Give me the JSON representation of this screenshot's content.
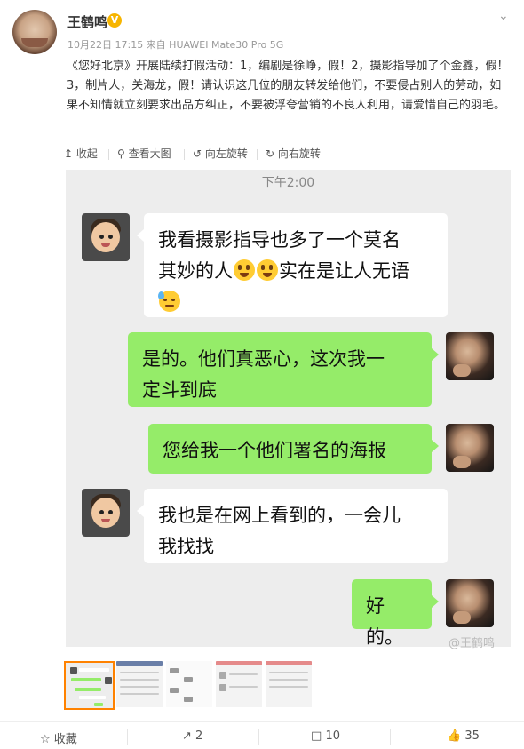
{
  "post": {
    "username": "王鹤鸣",
    "verified_badge": "V",
    "meta": "10月22日 17:15 来自 HUAWEI Mate30 Pro 5G",
    "text": "《您好北京》开展陆续打假活动：1，编剧是徐峥，假！2，摄影指导加了个金鑫，假！3，制片人，关海龙，假！请认识这几位的朋友转发给他们，不要侵占别人的劳动，如果不知情就立刻要求出品方纠正，不要被浮夸营销的不良人利用，请爱惜自己的羽毛。"
  },
  "toolbar": {
    "collapse": "收起",
    "view_large": "查看大图",
    "rotate_left": "向左旋转",
    "rotate_right": "向右旋转"
  },
  "chat": {
    "time": "下午2:00",
    "messages": [
      {
        "side": "left",
        "line1": "我看摄影指导也多了一个莫名",
        "line2a": "其妙的人",
        "line2b": "实在是让人无语"
      },
      {
        "side": "right",
        "line1": "是的。他们真恶心，这次我一",
        "line2": "定斗到底"
      },
      {
        "side": "right",
        "line1": "您给我一个他们署名的海报"
      },
      {
        "side": "left",
        "line1": "我也是在网上看到的，一会儿",
        "line2": "我找找"
      },
      {
        "side": "right",
        "line1": "好的。"
      }
    ],
    "watermark": "@王鹤鸣"
  },
  "actions": {
    "favorite": "收藏",
    "repost_count": "2",
    "comment_count": "10",
    "like_count": "35"
  },
  "colors": {
    "green_bubble": "#95ec69",
    "chat_bg": "#ededed",
    "verified": "#f7b500",
    "thumb_selected": "#ff8200"
  }
}
